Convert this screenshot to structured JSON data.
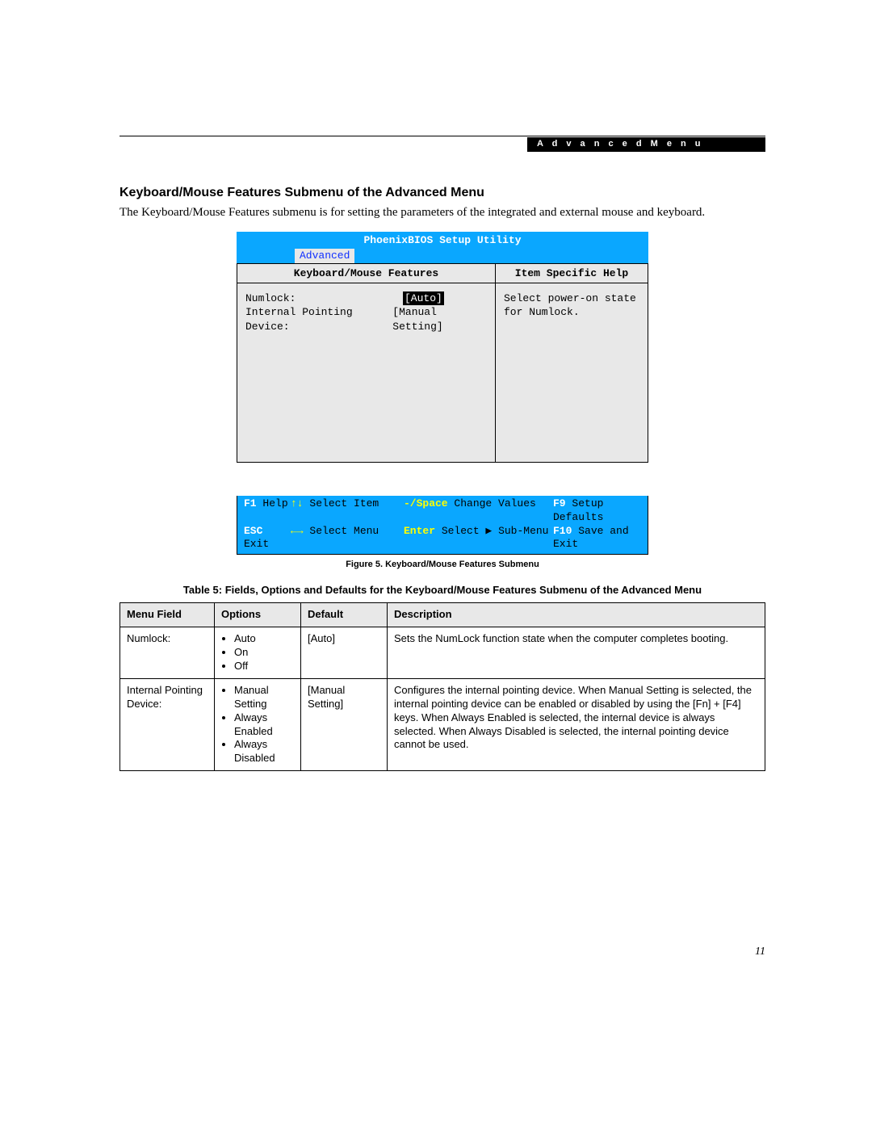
{
  "banner": "A d v a n c e d   M e n u",
  "heading": "Keyboard/Mouse Features Submenu of the Advanced Menu",
  "intro": "The Keyboard/Mouse Features submenu is for setting the parameters of the integrated and external mouse and keyboard.",
  "bios": {
    "title": "PhoenixBIOS Setup Utility",
    "active_tab": "Advanced",
    "left_header": "Keyboard/Mouse Features",
    "right_header": "Item Specific Help",
    "items": [
      {
        "label": "Numlock:",
        "value": "[Auto]",
        "highlight": true
      },
      {
        "label": "Internal Pointing Device:",
        "value": "[Manual Setting]",
        "highlight": false
      }
    ],
    "help_lines": [
      "Select power-on state",
      "for Numlock."
    ],
    "footer": {
      "row1": {
        "k1": "F1",
        "t1": "Help",
        "k2": "↑↓",
        "t2": "Select Item",
        "k3": "-/Space",
        "t3": "Change Values",
        "k4": "F9",
        "t4": "Setup Defaults"
      },
      "row2": {
        "k1": "ESC",
        "t1": "Exit",
        "k2": "←→",
        "t2": "Select Menu",
        "k3": "Enter",
        "t3": "Select ▶ Sub-Menu",
        "k4": "F10",
        "t4": "Save and Exit"
      }
    }
  },
  "figure_caption": "Figure 5.  Keyboard/Mouse Features Submenu",
  "table_caption": "Table 5: Fields, Options and Defaults for the Keyboard/Mouse Features Submenu of the Advanced Menu",
  "table": {
    "headers": [
      "Menu Field",
      "Options",
      "Default",
      "Description"
    ],
    "rows": [
      {
        "field": "Numlock:",
        "options": [
          "Auto",
          "On",
          "Off"
        ],
        "default": "[Auto]",
        "desc": "Sets the NumLock function state when the computer completes booting."
      },
      {
        "field": "Internal Pointing Device:",
        "options": [
          "Manual Setting",
          "Always Enabled",
          "Always Disabled"
        ],
        "default": "[Manual Setting]",
        "desc": "Configures the internal pointing device. When Manual Setting is selected, the internal pointing device can be enabled or disabled by using the [Fn] + [F4] keys. When Always Enabled is selected, the internal device is always selected. When Always Disabled is selected, the internal pointing device cannot be used."
      }
    ]
  },
  "page_number": "11"
}
